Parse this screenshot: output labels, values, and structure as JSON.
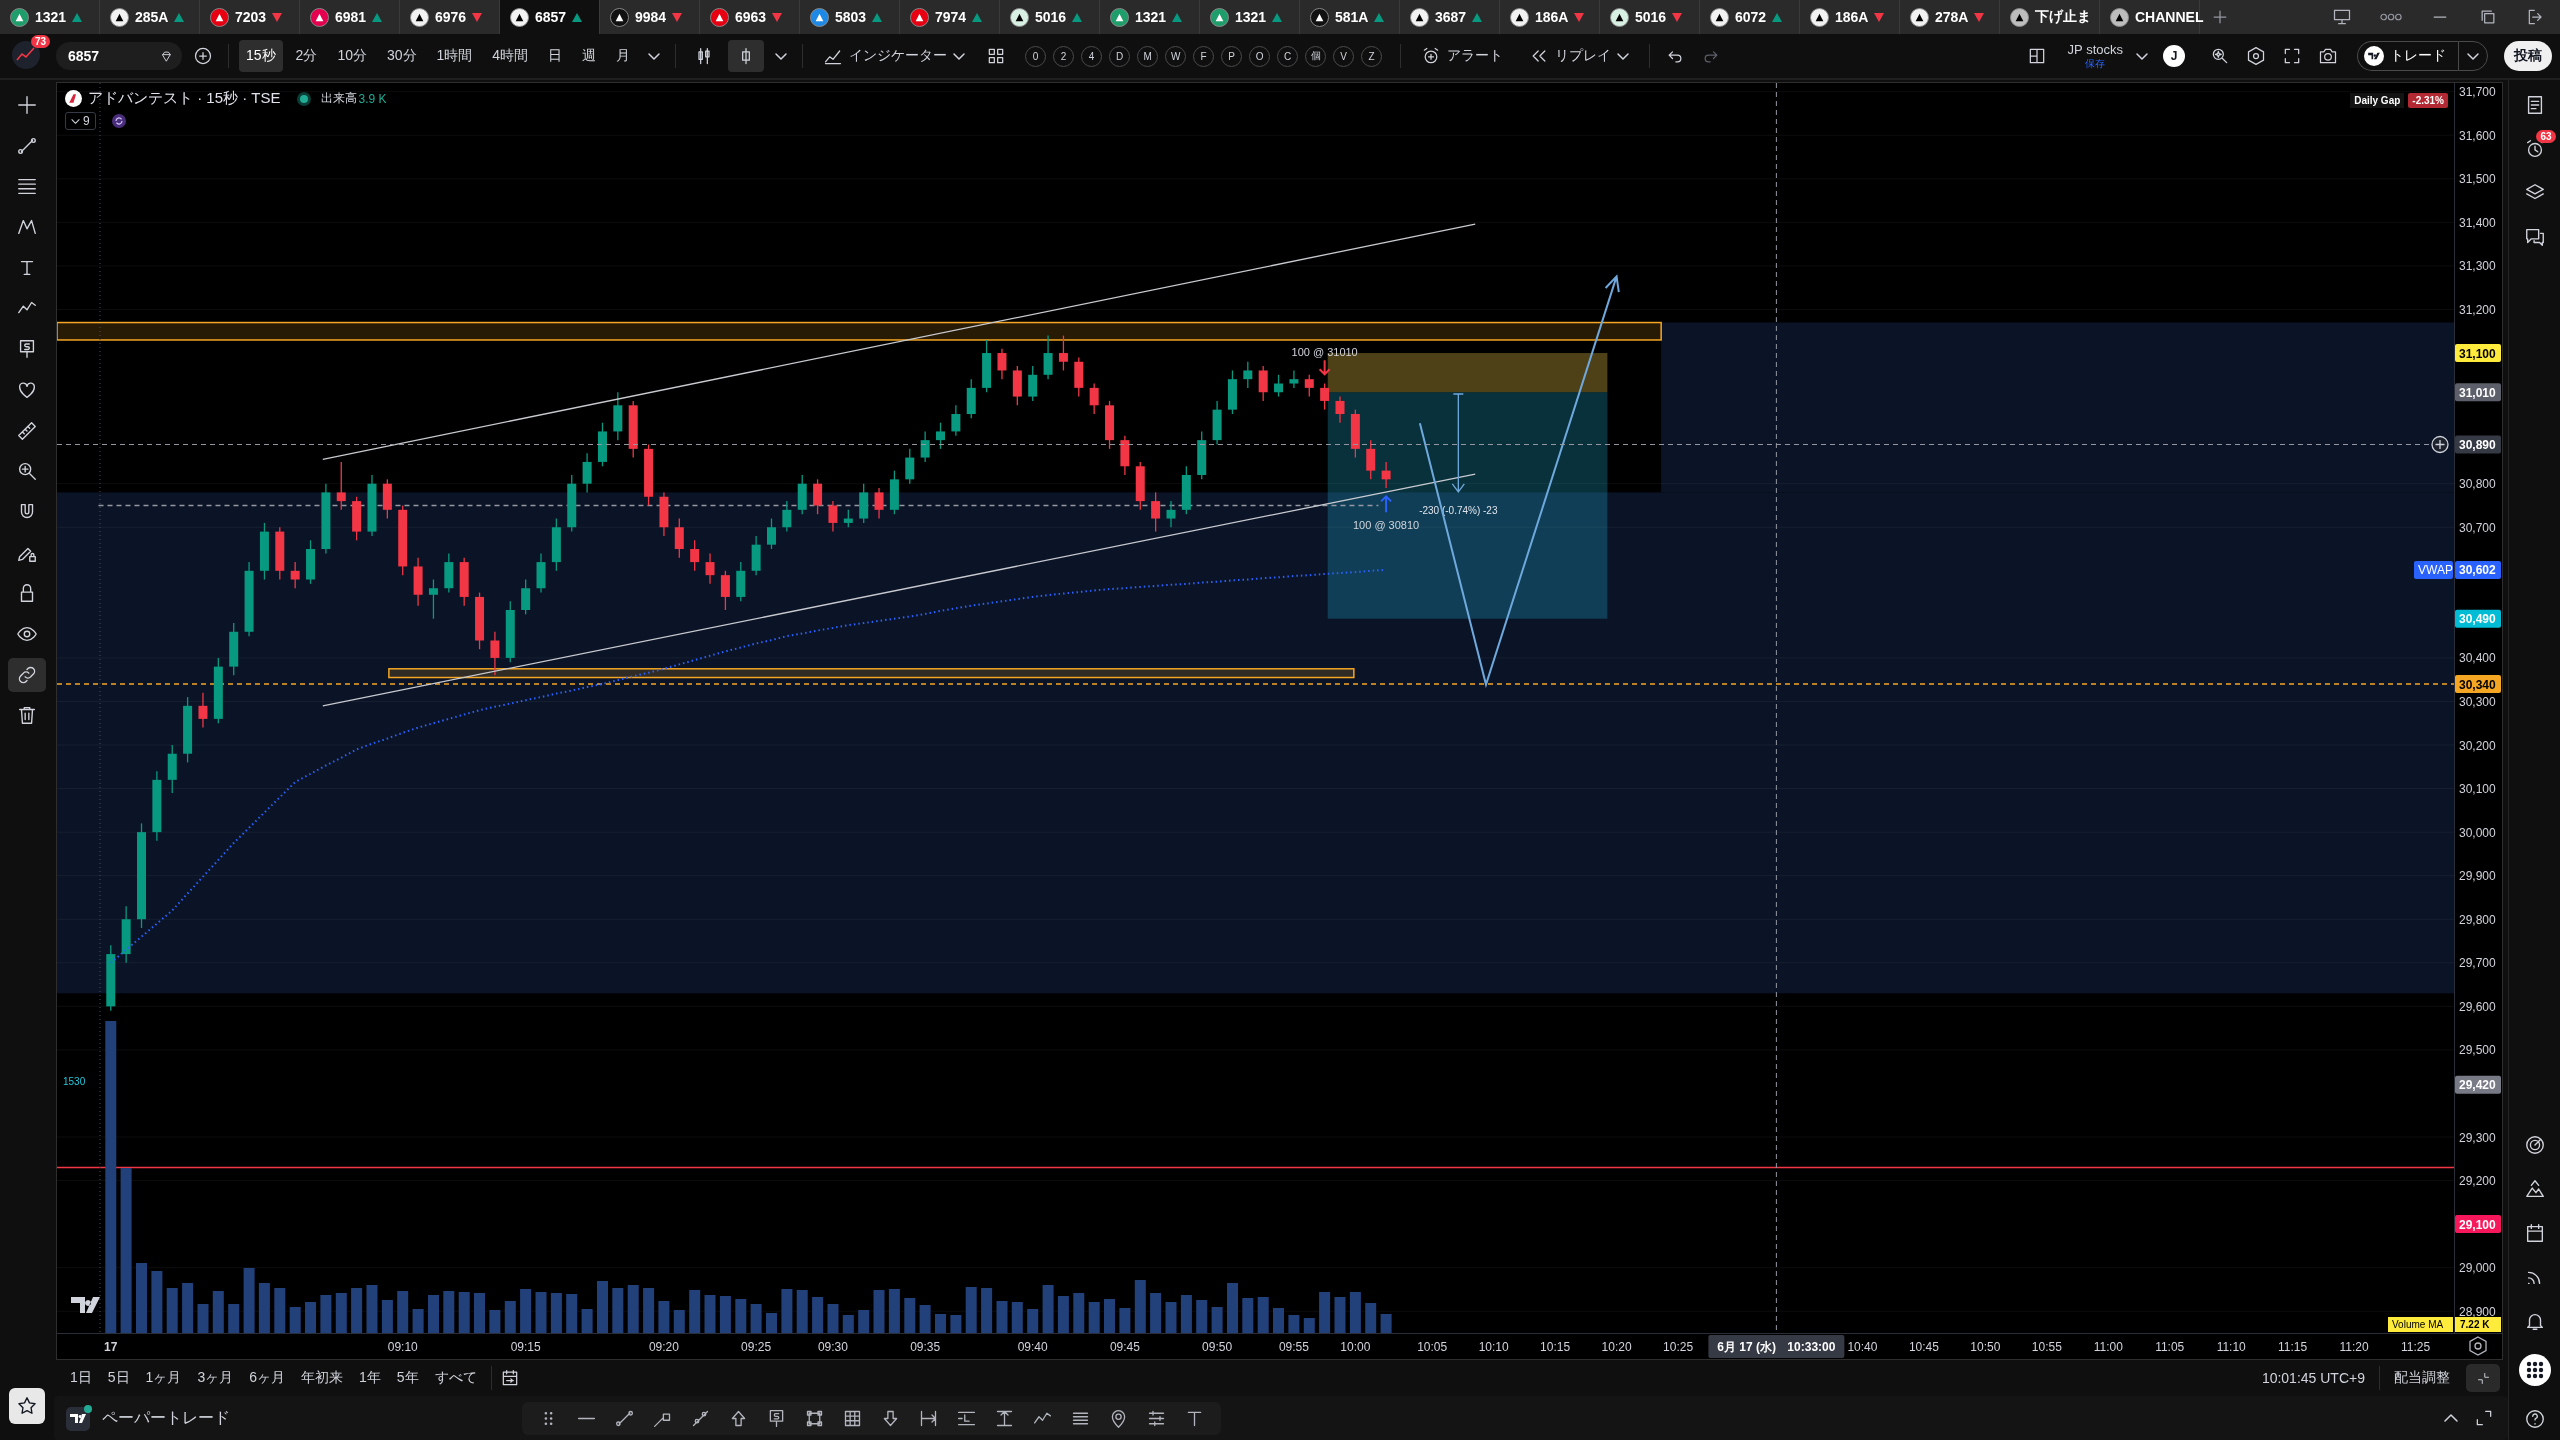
{
  "tabs": [
    {
      "label": "1321",
      "kind": "symbol",
      "rising": true,
      "color": "#1f9d6b",
      "selected": false
    },
    {
      "label": "285A",
      "kind": "symbol",
      "rising": true,
      "color": "#f2f2f2",
      "selected": false
    },
    {
      "label": "7203",
      "kind": "symbol",
      "rising": false,
      "color": "#e60012",
      "selected": false
    },
    {
      "label": "6981",
      "kind": "symbol",
      "rising": true,
      "color": "#e5004f",
      "selected": false
    },
    {
      "label": "6976",
      "kind": "symbol",
      "rising": false,
      "color": "#f2f2f2",
      "selected": false
    },
    {
      "label": "6857",
      "kind": "symbol",
      "rising": true,
      "color": "#f2f2f2",
      "selected": true
    },
    {
      "label": "9984",
      "kind": "symbol",
      "rising": false,
      "color": "#111111",
      "selected": false
    },
    {
      "label": "6963",
      "kind": "symbol",
      "rising": false,
      "color": "#e60012",
      "selected": false
    },
    {
      "label": "5803",
      "kind": "symbol",
      "rising": true,
      "color": "#1e88e5",
      "selected": false
    },
    {
      "label": "7974",
      "kind": "symbol",
      "rising": true,
      "color": "#e60012",
      "selected": false
    },
    {
      "label": "5016",
      "kind": "symbol",
      "rising": true,
      "color": "#d8efe4",
      "selected": false
    },
    {
      "label": "1321",
      "kind": "symbol",
      "rising": true,
      "color": "#1f9d6b",
      "selected": false
    },
    {
      "label": "1321",
      "kind": "symbol",
      "rising": true,
      "color": "#1f9d6b",
      "selected": false
    },
    {
      "label": "581A",
      "kind": "symbol",
      "rising": true,
      "color": "#111111",
      "selected": false
    },
    {
      "label": "3687",
      "kind": "symbol",
      "rising": true,
      "color": "#f2f2f2",
      "selected": false
    },
    {
      "label": "186A",
      "kind": "symbol",
      "rising": false,
      "color": "#f2f2f2",
      "selected": false
    },
    {
      "label": "5016",
      "kind": "symbol",
      "rising": false,
      "color": "#d8efe4",
      "selected": false
    },
    {
      "label": "6072",
      "kind": "symbol",
      "rising": true,
      "color": "#f2f2f2",
      "selected": false
    },
    {
      "label": "186A",
      "kind": "symbol",
      "rising": false,
      "color": "#f2f2f2",
      "selected": false
    },
    {
      "label": "278A",
      "kind": "symbol",
      "rising": false,
      "color": "#f2f2f2",
      "selected": false
    },
    {
      "label": "下げ止ま",
      "kind": "page",
      "color": "#bdbdbd",
      "selected": false
    },
    {
      "label": "CHANNEL",
      "kind": "page",
      "color": "#bdbdbd",
      "selected": false
    }
  ],
  "toolbar": {
    "notifications": "73",
    "symbol": "6857",
    "intervals": [
      {
        "label": "15秒",
        "selected": true
      },
      {
        "label": "2分",
        "selected": false
      },
      {
        "label": "10分",
        "selected": false
      },
      {
        "label": "30分",
        "selected": false
      },
      {
        "label": "1時間",
        "selected": false
      },
      {
        "label": "4時間",
        "selected": false
      },
      {
        "label": "日",
        "selected": false
      },
      {
        "label": "週",
        "selected": false
      },
      {
        "label": "月",
        "selected": false
      }
    ],
    "chart_styles": [
      {
        "kind": "candles",
        "selected": false
      },
      {
        "kind": "hollow_candle",
        "selected": true
      }
    ],
    "indicators": "インジケーター",
    "quick_buttons": [
      "0",
      "2",
      "4",
      "D",
      "M",
      "W",
      "F",
      "P",
      "O",
      "C",
      "個",
      "V",
      "Z"
    ],
    "alert": "アラート",
    "replay": "リプレイ",
    "layout_name": "JP stocks",
    "layout_status": "保存",
    "user_initial": "J",
    "trade": "トレード",
    "publish": "投稿"
  },
  "left_tools": [
    {
      "kind": "crosshair",
      "selected": false
    },
    {
      "kind": "trend_line",
      "selected": false
    },
    {
      "kind": "fib_lines",
      "selected": false
    },
    {
      "kind": "pattern",
      "selected": false
    },
    {
      "kind": "text",
      "selected": false
    },
    {
      "kind": "path",
      "selected": false
    },
    {
      "kind": "price_note",
      "selected": false
    },
    {
      "kind": "favorite",
      "selected": false
    },
    {
      "kind": "ruler",
      "selected": false
    },
    {
      "kind": "zoom",
      "selected": false
    },
    {
      "kind": "magnet",
      "selected": false
    },
    {
      "kind": "lock_drawing",
      "selected": false
    },
    {
      "kind": "lock",
      "selected": false
    },
    {
      "kind": "eye",
      "selected": false
    },
    {
      "kind": "link",
      "selected": true
    },
    {
      "kind": "trash",
      "selected": false
    }
  ],
  "legend": {
    "title": "アドバンテスト · 15秒 · TSE",
    "volume_label": "出来高",
    "volume_value": "3.9 K",
    "hidden_count": "9"
  },
  "daily_gap": {
    "label": "Daily Gap",
    "value": "-2.31%"
  },
  "chart": {
    "chart_data": [
      {
        "type": "candlestick",
        "grid": true,
        "categories": [
          null,
          null,
          null,
          "17",
          null,
          null,
          null,
          null,
          null,
          null,
          null,
          null,
          null,
          null,
          null,
          null,
          null,
          null,
          null,
          null,
          null,
          null,
          "09:10",
          null,
          null,
          null,
          null,
          null,
          null,
          null,
          "09:15",
          null,
          null,
          null,
          null,
          null,
          null,
          null,
          null,
          "09:20",
          null,
          null,
          null,
          null,
          null,
          "09:25",
          null,
          null,
          null,
          null,
          "09:30",
          null,
          null,
          null,
          null,
          null,
          "09:35",
          null,
          null,
          null,
          null,
          null,
          null,
          "09:40",
          null,
          null,
          null,
          null,
          null,
          "09:45",
          null,
          null,
          null,
          null,
          null,
          "09:50",
          null,
          null,
          null,
          null,
          "09:55",
          null,
          null,
          null,
          "10:00",
          null,
          null,
          null,
          null,
          "10:05",
          null,
          null,
          null,
          "10:10",
          null,
          null,
          null,
          "10:15",
          null,
          null,
          null,
          "10:20",
          null,
          null,
          null,
          "10:25",
          null,
          null,
          null,
          null,
          null,
          null,
          null,
          null,
          null,
          null,
          null,
          "10:40",
          null,
          null,
          null,
          "10:45",
          null,
          null,
          null,
          "10:50",
          null,
          null,
          null,
          "10:55",
          null,
          null,
          null,
          "11:00",
          null,
          null,
          null,
          "11:05",
          null,
          null,
          null,
          "11:10",
          null,
          null,
          null,
          "11:15",
          null,
          null,
          null,
          "11:20",
          null,
          null,
          null,
          "11:25",
          null,
          null
        ],
        "ohlc": [
          null,
          null,
          null,
          [
            29600,
            29740,
            29590,
            29720
          ],
          [
            29720,
            29830,
            29700,
            29800
          ],
          [
            29800,
            30020,
            29780,
            30000
          ],
          [
            30000,
            30140,
            29980,
            30120
          ],
          [
            30120,
            30200,
            30090,
            30180
          ],
          [
            30180,
            30310,
            30160,
            30290
          ],
          [
            30290,
            30320,
            30240,
            30260
          ],
          [
            30260,
            30400,
            30250,
            30380
          ],
          [
            30380,
            30480,
            30360,
            30460
          ],
          [
            30460,
            30620,
            30450,
            30600
          ],
          [
            30600,
            30710,
            30580,
            30690
          ],
          [
            30690,
            30700,
            30580,
            30600
          ],
          [
            30600,
            30620,
            30560,
            30580
          ],
          [
            30580,
            30670,
            30570,
            30650
          ],
          [
            30650,
            30800,
            30640,
            30780
          ],
          [
            30780,
            30850,
            30740,
            30760
          ],
          [
            30760,
            30770,
            30670,
            30690
          ],
          [
            30690,
            30820,
            30680,
            30800
          ],
          [
            30800,
            30810,
            30720,
            30740
          ],
          [
            30740,
            30750,
            30590,
            30610
          ],
          [
            30610,
            30630,
            30520,
            30545
          ],
          [
            30545,
            30580,
            30490,
            30560
          ],
          [
            30560,
            30640,
            30550,
            30620
          ],
          [
            30620,
            30630,
            30520,
            30540
          ],
          [
            30540,
            30550,
            30420,
            30440
          ],
          [
            30440,
            30460,
            30360,
            30400
          ],
          [
            30400,
            30530,
            30390,
            30510
          ],
          [
            30510,
            30580,
            30500,
            30560
          ],
          [
            30560,
            30640,
            30550,
            30620
          ],
          [
            30620,
            30720,
            30600,
            30700
          ],
          [
            30700,
            30820,
            30690,
            30800
          ],
          [
            30800,
            30870,
            30780,
            30850
          ],
          [
            30850,
            30940,
            30840,
            30920
          ],
          [
            30920,
            31010,
            30900,
            30980
          ],
          [
            30980,
            30990,
            30860,
            30880
          ],
          [
            30880,
            30890,
            30750,
            30770
          ],
          [
            30770,
            30780,
            30680,
            30700
          ],
          [
            30700,
            30720,
            30630,
            30650
          ],
          [
            30650,
            30670,
            30600,
            30620
          ],
          [
            30620,
            30640,
            30570,
            30590
          ],
          [
            30590,
            30600,
            30510,
            30540
          ],
          [
            30540,
            30620,
            30530,
            30600
          ],
          [
            30600,
            30680,
            30590,
            30660
          ],
          [
            30660,
            30720,
            30650,
            30700
          ],
          [
            30700,
            30760,
            30690,
            30740
          ],
          [
            30740,
            30820,
            30730,
            30800
          ],
          [
            30800,
            30810,
            30730,
            30750
          ],
          [
            30750,
            30760,
            30690,
            30710
          ],
          [
            30710,
            30740,
            30700,
            30720
          ],
          [
            30720,
            30800,
            30710,
            30780
          ],
          [
            30780,
            30790,
            30720,
            30740
          ],
          [
            30740,
            30830,
            30730,
            30810
          ],
          [
            30810,
            30880,
            30800,
            30860
          ],
          [
            30860,
            30920,
            30850,
            30900
          ],
          [
            30900,
            30940,
            30880,
            30920
          ],
          [
            30920,
            30980,
            30910,
            30960
          ],
          [
            30960,
            31040,
            30950,
            31020
          ],
          [
            31020,
            31130,
            31010,
            31100
          ],
          [
            31100,
            31110,
            31040,
            31060
          ],
          [
            31060,
            31070,
            30980,
            31000
          ],
          [
            31000,
            31070,
            30990,
            31050
          ],
          [
            31050,
            31140,
            31040,
            31100
          ],
          [
            31100,
            31140,
            31060,
            31080
          ],
          [
            31080,
            31090,
            31000,
            31020
          ],
          [
            31020,
            31030,
            30960,
            30980
          ],
          [
            30980,
            30990,
            30880,
            30900
          ],
          [
            30900,
            30910,
            30820,
            30840
          ],
          [
            30840,
            30850,
            30740,
            30760
          ],
          [
            30760,
            30780,
            30690,
            30720
          ],
          [
            30720,
            30760,
            30700,
            30740
          ],
          [
            30740,
            30840,
            30730,
            30820
          ],
          [
            30820,
            30920,
            30810,
            30900
          ],
          [
            30900,
            30990,
            30890,
            30970
          ],
          [
            30970,
            31060,
            30960,
            31040
          ],
          [
            31040,
            31080,
            31020,
            31060
          ],
          [
            31060,
            31070,
            30990,
            31010
          ],
          [
            31010,
            31050,
            31000,
            31030
          ],
          [
            31030,
            31060,
            31020,
            31040
          ],
          [
            31040,
            31050,
            31000,
            31020
          ],
          [
            31020,
            31030,
            30970,
            30990
          ],
          [
            30990,
            31000,
            30940,
            30960
          ],
          [
            30960,
            30970,
            30860,
            30880
          ],
          [
            30880,
            30900,
            30810,
            30830
          ],
          [
            30830,
            30850,
            30790,
            30810
          ],
          null,
          null,
          null,
          null,
          null,
          null,
          null,
          null,
          null,
          null,
          null,
          null,
          null,
          null,
          null,
          null,
          null,
          null,
          null,
          null,
          null,
          null,
          null,
          null,
          null,
          null,
          null,
          null,
          null,
          null,
          null,
          null,
          null,
          null,
          null,
          null,
          null,
          null,
          null,
          null,
          null,
          null,
          null,
          null,
          null,
          null,
          null,
          null,
          null,
          null,
          null,
          null,
          null,
          null,
          null,
          null,
          null,
          null,
          null,
          null,
          null,
          null,
          null,
          null,
          null,
          null,
          null,
          null,
          null
        ],
        "ylim": [
          28850,
          31720
        ],
        "yticks": [
          {
            "value": 28900,
            "label": "28,900"
          },
          {
            "value": 29000,
            "label": "29,000"
          },
          {
            "value": 29200,
            "label": "29,200"
          },
          {
            "value": 29300,
            "label": "29,300"
          },
          {
            "value": 29500,
            "label": "29,500"
          },
          {
            "value": 29600,
            "label": "29,600"
          },
          {
            "value": 29700,
            "label": "29,700"
          },
          {
            "value": 29800,
            "label": "29,800"
          },
          {
            "value": 29900,
            "label": "29,900"
          },
          {
            "value": 30000,
            "label": "30,000"
          },
          {
            "value": 30100,
            "label": "30,100"
          },
          {
            "value": 30200,
            "label": "30,200"
          },
          {
            "value": 30300,
            "label": "30,300"
          },
          {
            "value": 30400,
            "label": "30,400"
          },
          {
            "value": 30700,
            "label": "30,700"
          },
          {
            "value": 30800,
            "label": "30,800"
          },
          {
            "value": 31200,
            "label": "31,200"
          },
          {
            "value": 31300,
            "label": "31,300"
          },
          {
            "value": 31400,
            "label": "31,400"
          },
          {
            "value": 31500,
            "label": "31,500"
          },
          {
            "value": 31600,
            "label": "31,600"
          },
          {
            "value": 31700,
            "label": "31,700"
          }
        ],
        "series": [
          {
            "name": "VWAP",
            "type": "line",
            "color": "#2962ff",
            "line_style": "dotted",
            "values": [
              null,
              null,
              null,
              29700,
              29730,
              29760,
              29790,
              29820,
              29859,
              29898,
              29936,
              29975,
              30010,
              30045,
              30080,
              30115,
              30134,
              30153,
              30171,
              30190,
              30203,
              30215,
              30228,
              30240,
              30250,
              30260,
              30270,
              30280,
              30288,
              30295,
              30303,
              30310,
              30318,
              30325,
              30333,
              30340,
              30349,
              30358,
              30366,
              30375,
              30385,
              30395,
              30405,
              30415,
              30424,
              30433,
              30441,
              30450,
              30456,
              30463,
              30469,
              30475,
              30480,
              30485,
              30490,
              30495,
              30501,
              30508,
              30514,
              30520,
              30525,
              30530,
              30535,
              30540,
              30544,
              30548,
              30551,
              30555,
              30558,
              30560,
              30563,
              30565,
              30568,
              30570,
              30573,
              30575,
              30578,
              30580,
              30583,
              30585,
              30588,
              30590,
              30593,
              30595,
              30597,
              30600,
              30602,
              null,
              null,
              null,
              null,
              null,
              null,
              null,
              null,
              null,
              null,
              null,
              null,
              null,
              null,
              null,
              null,
              null,
              null,
              null,
              null,
              null,
              null,
              null,
              null,
              null,
              null,
              null,
              null,
              null,
              null,
              null,
              null,
              null,
              null,
              null,
              null,
              null,
              null,
              null,
              null,
              null,
              null,
              null,
              null,
              null,
              null,
              null,
              null,
              null,
              null,
              null,
              null,
              null,
              null,
              null,
              null,
              null,
              null,
              null,
              null,
              null,
              null,
              null,
              null,
              null,
              null,
              null,
              null,
              null
            ]
          }
        ],
        "ref_lines": [
          {
            "axis": "y",
            "value": 30340,
            "color": "#f5a623",
            "line_style": "dashed"
          },
          {
            "axis": "y",
            "value": 29230,
            "color": "#f23645",
            "line_style": "solid"
          },
          {
            "axis": "y",
            "value": 30750,
            "color": "#9598a1",
            "line_style": "dashed"
          }
        ],
        "bands": [
          {
            "axis": "y",
            "from": 29630,
            "to": 30780,
            "color": "#0b1426"
          },
          {
            "axis": "y",
            "from": 30780,
            "to": 31170,
            "color": "#0b1426"
          },
          {
            "axis": "y",
            "from": 31130,
            "to": 31170,
            "color": "#f5a623"
          },
          {
            "axis": "y",
            "from": 30355,
            "to": 30375,
            "color": "#f5a623"
          },
          {
            "axis": "y",
            "from": 31010,
            "to": 31100,
            "color": "#f2c94c"
          },
          {
            "axis": "y",
            "from": 30490,
            "to": 31010,
            "color": "#1aa3c8"
          }
        ],
        "annotations": [
          "-230 (-0.74%) -23"
        ]
      }
    ],
    "price_labels": [
      {
        "kind": "level",
        "text": "31,100",
        "color": "#ffeb3b"
      },
      {
        "kind": "level",
        "text": "31,010",
        "color": "#5d606b"
      },
      {
        "kind": "crosshair",
        "text": "30,890",
        "color": "#363a45"
      },
      {
        "kind": "level",
        "text": "30,602",
        "color": "#2962ff"
      },
      {
        "kind": "level",
        "text": "30,490",
        "color": "#00bcd4"
      },
      {
        "kind": "level",
        "text": "30,340",
        "color": "#f5a623"
      },
      {
        "kind": "level",
        "text": "29,420",
        "color": "#787b86"
      },
      {
        "kind": "level",
        "text": "29,100",
        "color": "#f7185c"
      }
    ],
    "trades": [
      {
        "kind": "sell",
        "label": "100 @ 31010"
      },
      {
        "kind": "buy",
        "label": "100 @ 30810"
      }
    ],
    "crosshair": {
      "date": "6月 17 (水)",
      "time": "10:33:00"
    }
  },
  "volume": {
    "marker": "1530",
    "ma_label": "Volume MA",
    "ma_value": "7.22 K"
  },
  "right_sidebar": {
    "alerts_badge": "63"
  },
  "range_bar": {
    "ranges": [
      "1日",
      "5日",
      "1ヶ月",
      "3ヶ月",
      "6ヶ月",
      "年初来",
      "1年",
      "5年",
      "すべて"
    ],
    "clock": "10:01:45 UTC+9",
    "adjustment": "配当調整"
  },
  "bottom_panel": {
    "title": "ペーパートレード"
  }
}
